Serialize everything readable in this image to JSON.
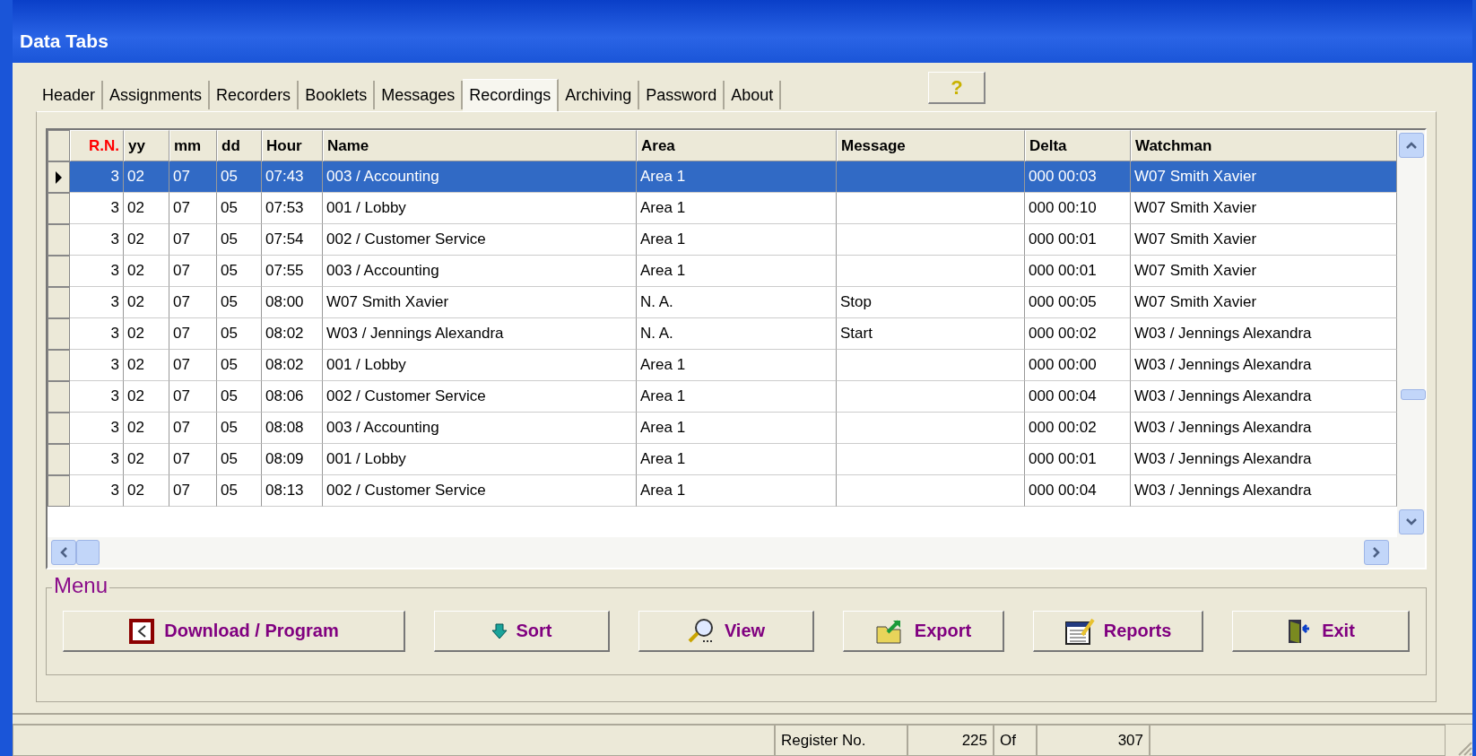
{
  "window": {
    "title": "Data Tabs"
  },
  "tabs": [
    {
      "label": "Header",
      "selected": false
    },
    {
      "label": "Assignments",
      "selected": false
    },
    {
      "label": "Recorders",
      "selected": false
    },
    {
      "label": "Booklets",
      "selected": false
    },
    {
      "label": "Messages",
      "selected": false
    },
    {
      "label": "Recordings",
      "selected": true
    },
    {
      "label": "Archiving",
      "selected": false
    },
    {
      "label": "Password",
      "selected": false
    },
    {
      "label": "About",
      "selected": false
    }
  ],
  "help_button": {
    "label": "?"
  },
  "table": {
    "columns": [
      {
        "label": "R.N.",
        "color": "#ff0000",
        "kind": "number"
      },
      {
        "label": "yy",
        "color": "#000000",
        "kind": "text"
      },
      {
        "label": "mm",
        "color": "#000000",
        "kind": "text"
      },
      {
        "label": "dd",
        "color": "#000000",
        "kind": "text"
      },
      {
        "label": "Hour",
        "color": "#000000",
        "kind": "text"
      },
      {
        "label": "Name",
        "color": "#000000",
        "kind": "text"
      },
      {
        "label": "Area",
        "color": "#000000",
        "kind": "text"
      },
      {
        "label": "Message",
        "color": "#000000",
        "kind": "text"
      },
      {
        "label": "Delta",
        "color": "#000000",
        "kind": "text"
      },
      {
        "label": "Watchman",
        "color": "#000000",
        "kind": "text"
      }
    ],
    "rows": [
      {
        "selected": true,
        "cells": [
          "3",
          "02",
          "07",
          "05",
          "07:43",
          "003 / Accounting",
          "Area 1",
          "",
          "000 00:03",
          "W07 Smith Xavier"
        ]
      },
      {
        "selected": false,
        "cells": [
          "3",
          "02",
          "07",
          "05",
          "07:53",
          "001 / Lobby",
          "Area 1",
          "",
          "000 00:10",
          "W07 Smith Xavier"
        ]
      },
      {
        "selected": false,
        "cells": [
          "3",
          "02",
          "07",
          "05",
          "07:54",
          "002 / Customer Service",
          "Area 1",
          "",
          "000 00:01",
          "W07 Smith Xavier"
        ]
      },
      {
        "selected": false,
        "cells": [
          "3",
          "02",
          "07",
          "05",
          "07:55",
          "003 / Accounting",
          "Area 1",
          "",
          "000 00:01",
          "W07 Smith Xavier"
        ]
      },
      {
        "selected": false,
        "cells": [
          "3",
          "02",
          "07",
          "05",
          "08:00",
          "W07 Smith Xavier",
          "N. A.",
          "Stop",
          "000 00:05",
          "W07 Smith Xavier"
        ]
      },
      {
        "selected": false,
        "cells": [
          "3",
          "02",
          "07",
          "05",
          "08:02",
          "W03 / Jennings Alexandra",
          "N. A.",
          "Start",
          "000 00:02",
          "W03 / Jennings Alexandra"
        ]
      },
      {
        "selected": false,
        "cells": [
          "3",
          "02",
          "07",
          "05",
          "08:02",
          "001 / Lobby",
          "Area 1",
          "",
          "000 00:00",
          "W03 / Jennings Alexandra"
        ]
      },
      {
        "selected": false,
        "cells": [
          "3",
          "02",
          "07",
          "05",
          "08:06",
          "002 / Customer Service",
          "Area 1",
          "",
          "000 00:04",
          "W03 / Jennings Alexandra"
        ]
      },
      {
        "selected": false,
        "cells": [
          "3",
          "02",
          "07",
          "05",
          "08:08",
          "003 / Accounting",
          "Area 1",
          "",
          "000 00:02",
          "W03 / Jennings Alexandra"
        ]
      },
      {
        "selected": false,
        "cells": [
          "3",
          "02",
          "07",
          "05",
          "08:09",
          "001 / Lobby",
          "Area 1",
          "",
          "000 00:01",
          "W03 / Jennings Alexandra"
        ]
      },
      {
        "selected": false,
        "cells": [
          "3",
          "02",
          "07",
          "05",
          "08:13",
          "002 / Customer Service",
          "Area 1",
          "",
          "000 00:04",
          "W03 / Jennings Alexandra"
        ]
      }
    ]
  },
  "menu": {
    "title": "Menu",
    "buttons": [
      {
        "label": "Download / Program",
        "kind": "download"
      },
      {
        "label": "Sort",
        "kind": "sort"
      },
      {
        "label": "View",
        "kind": "view"
      },
      {
        "label": "Export",
        "kind": "export"
      },
      {
        "label": "Reports",
        "kind": "reports"
      },
      {
        "label": "Exit",
        "kind": "exit"
      }
    ]
  },
  "status_bar": {
    "label": "Register No.",
    "current": "225",
    "separator": "Of",
    "total": "307"
  }
}
